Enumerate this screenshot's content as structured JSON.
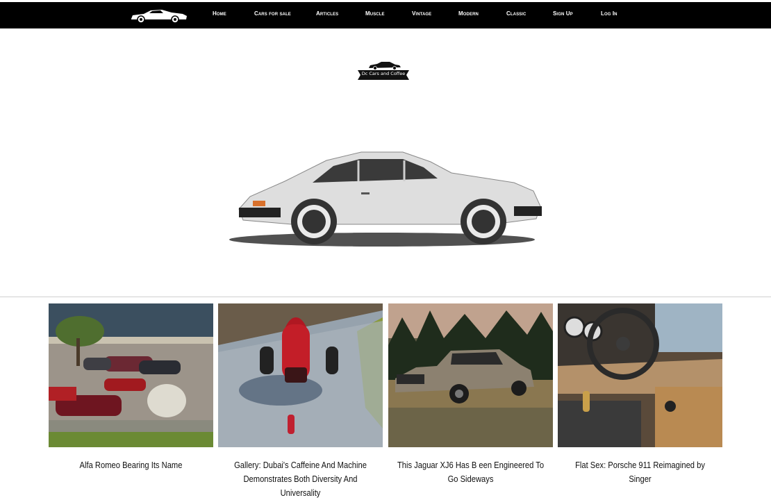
{
  "nav": {
    "items": [
      {
        "label": "Home"
      },
      {
        "label": "Cars for sale"
      },
      {
        "label": "Articles"
      },
      {
        "label": "Muscle"
      },
      {
        "label": "Vintage"
      },
      {
        "label": "Modern"
      },
      {
        "label": "Classic"
      },
      {
        "label": "Sign Up"
      },
      {
        "label": "Log In"
      }
    ]
  },
  "brand": {
    "caption": "Dc Cars and Coffee"
  },
  "articles": [
    {
      "title": "Alfa Romeo Bearing Its Name"
    },
    {
      "title": "Gallery: Dubai's Caffeine And Machine Demonstrates Both Diversity And Universality"
    },
    {
      "title": "This Jaguar XJ6 Has B een Engineered To Go Sideways"
    },
    {
      "title": "Flat Sex: Porsche 911 Reimagined by Singer"
    }
  ]
}
